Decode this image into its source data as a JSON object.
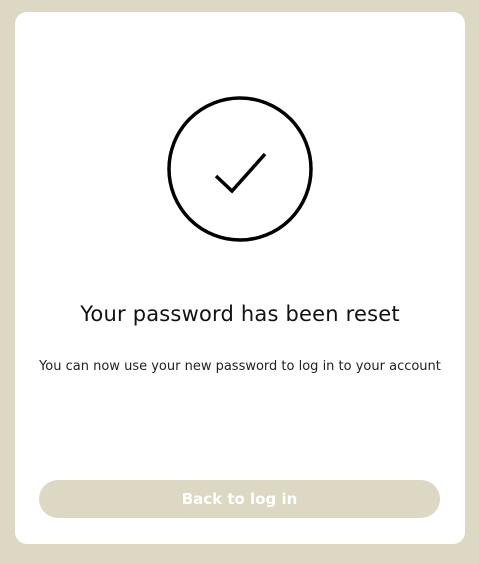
{
  "card": {
    "icon": "check-circle-icon",
    "title": "Your password has been reset",
    "message": "You can now use your new password to log in to your account",
    "button_label": "Back to log in"
  },
  "colors": {
    "background": "#dcd8c4",
    "card": "#ffffff",
    "button_bg": "#dcd8c4",
    "button_text": "#ffffff",
    "text": "#111111"
  }
}
